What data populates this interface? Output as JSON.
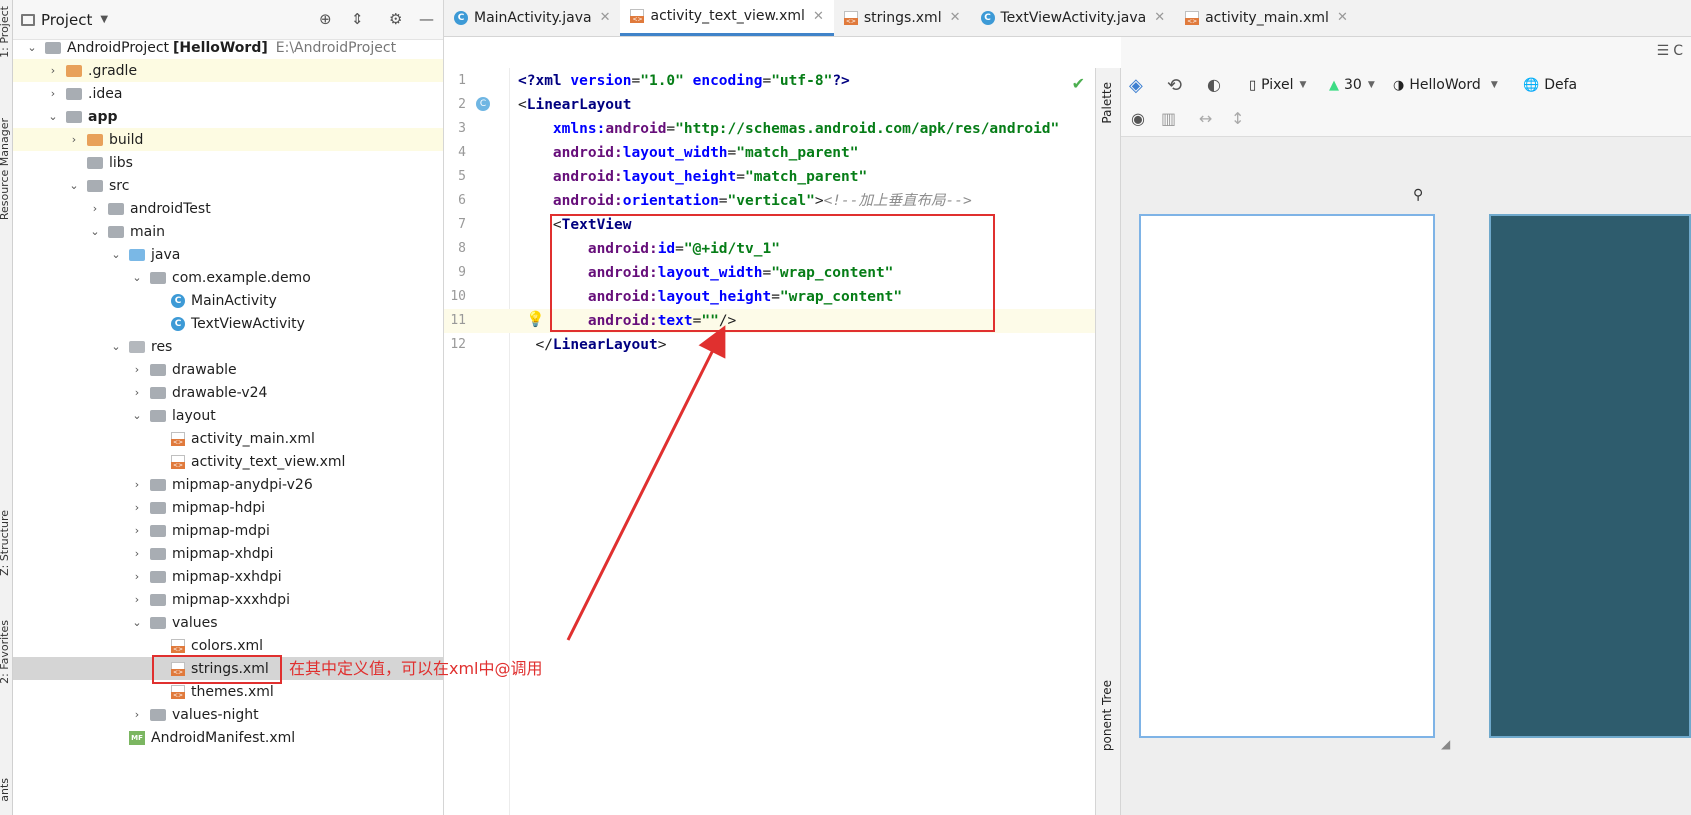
{
  "left_strip": {
    "tabs": [
      "1: Project",
      "Resource Manager",
      "Z: Structure",
      "2: Favorites",
      "ants"
    ]
  },
  "project_panel": {
    "title": "Project",
    "icons": [
      "project-view-icon",
      "dropdown-chevron-icon",
      "locate-icon",
      "collapse-all-icon",
      "gear-icon",
      "minimize-icon"
    ],
    "tree": [
      {
        "label": "AndroidProject",
        "bold_suffix": "[HelloWord]",
        "hint": "E:\\AndroidProject",
        "icon": "module-folder",
        "arrow": "down",
        "level": 0
      },
      {
        "label": ".gradle",
        "icon": "folder-orange",
        "arrow": "right",
        "level": 1,
        "highlight": true
      },
      {
        "label": ".idea",
        "icon": "folder-grey",
        "arrow": "right",
        "level": 1
      },
      {
        "label": "app",
        "icon": "folder-module",
        "arrow": "down",
        "level": 1,
        "bold": true
      },
      {
        "label": "build",
        "icon": "folder-orange",
        "arrow": "right",
        "level": 2,
        "highlight": true
      },
      {
        "label": "libs",
        "icon": "folder-grey",
        "arrow": "",
        "level": 2
      },
      {
        "label": "src",
        "icon": "folder-grey",
        "arrow": "down",
        "level": 2
      },
      {
        "label": "androidTest",
        "icon": "folder-grey",
        "arrow": "right",
        "level": 3
      },
      {
        "label": "main",
        "icon": "folder-grey",
        "arrow": "down",
        "level": 3
      },
      {
        "label": "java",
        "icon": "folder-blue",
        "arrow": "down",
        "level": 4
      },
      {
        "label": "com.example.demo",
        "icon": "package",
        "arrow": "down",
        "level": 5
      },
      {
        "label": "MainActivity",
        "icon": "class",
        "arrow": "",
        "level": 6
      },
      {
        "label": "TextViewActivity",
        "icon": "class",
        "arrow": "",
        "level": 6
      },
      {
        "label": "res",
        "icon": "folder-res",
        "arrow": "down",
        "level": 4
      },
      {
        "label": "drawable",
        "icon": "folder-grey",
        "arrow": "right",
        "level": 5
      },
      {
        "label": "drawable-v24",
        "icon": "folder-grey",
        "arrow": "right",
        "level": 5
      },
      {
        "label": "layout",
        "icon": "folder-grey",
        "arrow": "down",
        "level": 5
      },
      {
        "label": "activity_main.xml",
        "icon": "xml",
        "arrow": "",
        "level": 6
      },
      {
        "label": "activity_text_view.xml",
        "icon": "xml",
        "arrow": "",
        "level": 6
      },
      {
        "label": "mipmap-anydpi-v26",
        "icon": "folder-grey",
        "arrow": "right",
        "level": 5
      },
      {
        "label": "mipmap-hdpi",
        "icon": "folder-grey",
        "arrow": "right",
        "level": 5
      },
      {
        "label": "mipmap-mdpi",
        "icon": "folder-grey",
        "arrow": "right",
        "level": 5
      },
      {
        "label": "mipmap-xhdpi",
        "icon": "folder-grey",
        "arrow": "right",
        "level": 5
      },
      {
        "label": "mipmap-xxhdpi",
        "icon": "folder-grey",
        "arrow": "right",
        "level": 5
      },
      {
        "label": "mipmap-xxxhdpi",
        "icon": "folder-grey",
        "arrow": "right",
        "level": 5
      },
      {
        "label": "values",
        "icon": "folder-grey",
        "arrow": "down",
        "level": 5
      },
      {
        "label": "colors.xml",
        "icon": "xml",
        "arrow": "",
        "level": 6
      },
      {
        "label": "strings.xml",
        "icon": "xml",
        "arrow": "",
        "level": 6,
        "selected": true
      },
      {
        "label": "themes.xml",
        "icon": "xml",
        "arrow": "",
        "level": 6
      },
      {
        "label": "values-night",
        "icon": "folder-grey",
        "arrow": "right",
        "level": 5
      },
      {
        "label": "AndroidManifest.xml",
        "icon": "manifest",
        "arrow": "",
        "level": 4
      }
    ]
  },
  "editor_tabs": [
    {
      "label": "MainActivity.java",
      "icon": "class",
      "active": false
    },
    {
      "label": "activity_text_view.xml",
      "icon": "xml",
      "active": true
    },
    {
      "label": "strings.xml",
      "icon": "xml",
      "active": false
    },
    {
      "label": "TextViewActivity.java",
      "icon": "class",
      "active": false
    },
    {
      "label": "activity_main.xml",
      "icon": "xml",
      "active": false
    }
  ],
  "editor": {
    "line_numbers": [
      "1",
      "2",
      "3",
      "4",
      "5",
      "6",
      "7",
      "8",
      "9",
      "10",
      "11",
      "12"
    ],
    "lines": [
      [
        {
          "t": "<?",
          "c": "tag"
        },
        {
          "t": "xml ",
          "c": "tag"
        },
        {
          "t": "version",
          "c": "attr"
        },
        {
          "t": "=",
          "c": ""
        },
        {
          "t": "\"1.0\"",
          "c": "val"
        },
        {
          "t": " encoding",
          "c": "attr"
        },
        {
          "t": "=",
          "c": ""
        },
        {
          "t": "\"utf-8\"",
          "c": "val"
        },
        {
          "t": "?>",
          "c": "tag"
        }
      ],
      [
        {
          "t": "<",
          "c": ""
        },
        {
          "t": "LinearLayout",
          "c": "tag"
        }
      ],
      [
        {
          "t": "    xmlns:",
          "c": "attr"
        },
        {
          "t": "android",
          "c": "attrp"
        },
        {
          "t": "=",
          "c": ""
        },
        {
          "t": "\"http://schemas.android.com/apk/res/android\"",
          "c": "val"
        }
      ],
      [
        {
          "t": "    android:",
          "c": "attrp"
        },
        {
          "t": "layout_width",
          "c": "attr"
        },
        {
          "t": "=",
          "c": ""
        },
        {
          "t": "\"match_parent\"",
          "c": "val"
        }
      ],
      [
        {
          "t": "    android:",
          "c": "attrp"
        },
        {
          "t": "layout_height",
          "c": "attr"
        },
        {
          "t": "=",
          "c": ""
        },
        {
          "t": "\"match_parent\"",
          "c": "val"
        }
      ],
      [
        {
          "t": "    android:",
          "c": "attrp"
        },
        {
          "t": "orientation",
          "c": "attr"
        },
        {
          "t": "=",
          "c": ""
        },
        {
          "t": "\"vertical\"",
          "c": "val"
        },
        {
          "t": ">",
          "c": ""
        },
        {
          "t": "<!--加上垂直布局-->",
          "c": "cmt"
        }
      ],
      [
        {
          "t": "    <",
          "c": ""
        },
        {
          "t": "TextView",
          "c": "tag"
        }
      ],
      [
        {
          "t": "        android:",
          "c": "attrp"
        },
        {
          "t": "id",
          "c": "attr"
        },
        {
          "t": "=",
          "c": ""
        },
        {
          "t": "\"@+id/tv_1\"",
          "c": "val"
        }
      ],
      [
        {
          "t": "        android:",
          "c": "attrp"
        },
        {
          "t": "layout_width",
          "c": "attr"
        },
        {
          "t": "=",
          "c": ""
        },
        {
          "t": "\"wrap_content\"",
          "c": "val"
        }
      ],
      [
        {
          "t": "        android:",
          "c": "attrp"
        },
        {
          "t": "layout_height",
          "c": "attr"
        },
        {
          "t": "=",
          "c": ""
        },
        {
          "t": "\"wrap_content\"",
          "c": "val"
        }
      ],
      [
        {
          "t": "        android:",
          "c": "attrp"
        },
        {
          "t": "text",
          "c": "attr"
        },
        {
          "t": "=",
          "c": ""
        },
        {
          "t": "\"\"",
          "c": "val"
        },
        {
          "t": "/>",
          "c": ""
        }
      ],
      [
        {
          "t": "  </",
          "c": ""
        },
        {
          "t": "LinearLayout",
          "c": "tag"
        },
        {
          "t": ">",
          "c": ""
        }
      ]
    ]
  },
  "palette": {
    "tab_top": "Palette",
    "tab_bottom": "ponent Tree"
  },
  "design_toolbar": {
    "device": "Pixel",
    "api": "30",
    "theme": "HelloWord",
    "locale": "Defa",
    "cut_right": "C"
  },
  "annotation": {
    "text": "在其中定义值，可以在xml中@调用",
    "color": "#e0302f"
  }
}
